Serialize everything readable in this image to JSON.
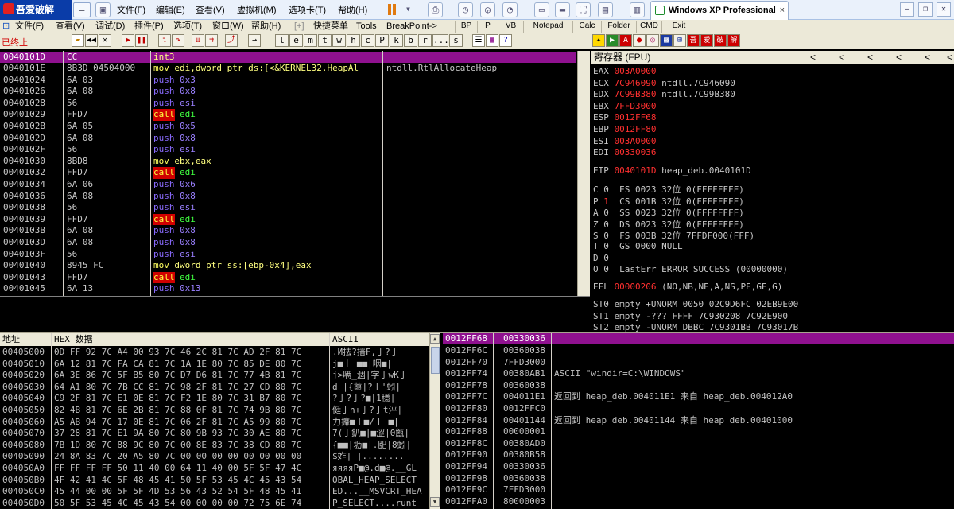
{
  "vm_bar": {
    "brand": "吾爱破解",
    "minimize_label": "–",
    "menus": [
      "文件(F)",
      "编辑(E)",
      "查看(V)",
      "虚拟机(M)",
      "选项卡(T)",
      "帮助(H)"
    ],
    "tab_title": "Windows XP Professional",
    "tab_close": "×"
  },
  "od_menu": {
    "items": [
      "文件(F)",
      "查看(V)",
      "调试(D)",
      "插件(P)",
      "选项(T)",
      "窗口(W)",
      "帮助(H)"
    ],
    "quick_label": "快捷菜单",
    "tools_label": "Tools",
    "breakpoint_label": "BreakPoint->",
    "plugins": [
      "BP",
      "P",
      "VB",
      "Notepad",
      "Calc",
      "Folder",
      "CMD",
      "Exit"
    ]
  },
  "toolbar": {
    "status": "已终止",
    "letters": [
      "l",
      "e",
      "m",
      "t",
      "w",
      "h",
      "c",
      "P",
      "k",
      "b",
      "r",
      "...",
      "s"
    ]
  },
  "cpu": {
    "header": [
      "0040101D",
      "CC",
      "int3"
    ],
    "rows": [
      {
        "addr": "0040101E",
        "hex": "8B3D 04504000",
        "mn": "mov",
        "ops": "edi,dword ptr ds:[<&KERNEL32.HeapAl",
        "cmt": "ntdll.RtlAllocateHeap",
        "t": "mov"
      },
      {
        "addr": "00401024",
        "hex": "6A 03",
        "mn": "push",
        "ops": "0x3",
        "t": "push"
      },
      {
        "addr": "00401026",
        "hex": "6A 08",
        "mn": "push",
        "ops": "0x8",
        "t": "push"
      },
      {
        "addr": "00401028",
        "hex": "56",
        "mn": "push",
        "ops": "esi",
        "t": "push"
      },
      {
        "addr": "00401029",
        "hex": "FFD7",
        "mn": "call",
        "ops": "edi",
        "t": "call"
      },
      {
        "addr": "0040102B",
        "hex": "6A 05",
        "mn": "push",
        "ops": "0x5",
        "t": "push"
      },
      {
        "addr": "0040102D",
        "hex": "6A 08",
        "mn": "push",
        "ops": "0x8",
        "t": "push"
      },
      {
        "addr": "0040102F",
        "hex": "56",
        "mn": "push",
        "ops": "esi",
        "t": "push"
      },
      {
        "addr": "00401030",
        "hex": "8BD8",
        "mn": "mov",
        "ops": "ebx,eax",
        "t": "mov"
      },
      {
        "addr": "00401032",
        "hex": "FFD7",
        "mn": "call",
        "ops": "edi",
        "t": "call"
      },
      {
        "addr": "00401034",
        "hex": "6A 06",
        "mn": "push",
        "ops": "0x6",
        "t": "push"
      },
      {
        "addr": "00401036",
        "hex": "6A 08",
        "mn": "push",
        "ops": "0x8",
        "t": "push"
      },
      {
        "addr": "00401038",
        "hex": "56",
        "mn": "push",
        "ops": "esi",
        "t": "push"
      },
      {
        "addr": "00401039",
        "hex": "FFD7",
        "mn": "call",
        "ops": "edi",
        "t": "call"
      },
      {
        "addr": "0040103B",
        "hex": "6A 08",
        "mn": "push",
        "ops": "0x8",
        "t": "push"
      },
      {
        "addr": "0040103D",
        "hex": "6A 08",
        "mn": "push",
        "ops": "0x8",
        "t": "push"
      },
      {
        "addr": "0040103F",
        "hex": "56",
        "mn": "push",
        "ops": "esi",
        "t": "push"
      },
      {
        "addr": "00401040",
        "hex": "8945 FC",
        "mn": "mov",
        "ops": "dword ptr ss:[ebp-0x4],eax",
        "t": "mov"
      },
      {
        "addr": "00401043",
        "hex": "FFD7",
        "mn": "call",
        "ops": "edi",
        "t": "call"
      },
      {
        "addr": "00401045",
        "hex": "6A 13",
        "mn": "push",
        "ops": "0x13",
        "t": "push"
      }
    ]
  },
  "registers": {
    "title": "寄存器 (FPU)",
    "arrows": [
      "<",
      "<",
      "<",
      "<",
      "<",
      "<"
    ],
    "gp": [
      {
        "name": "EAX",
        "value": "003A0000",
        "note": ""
      },
      {
        "name": "ECX",
        "value": "7C946090",
        "note": "ntdll.7C946090"
      },
      {
        "name": "EDX",
        "value": "7C99B380",
        "note": "ntdll.7C99B380"
      },
      {
        "name": "EBX",
        "value": "7FFD3000",
        "note": ""
      },
      {
        "name": "ESP",
        "value": "0012FF68",
        "note": ""
      },
      {
        "name": "EBP",
        "value": "0012FF80",
        "note": ""
      },
      {
        "name": "ESI",
        "value": "003A0000",
        "note": ""
      },
      {
        "name": "EDI",
        "value": "00330036",
        "note": ""
      }
    ],
    "eip": {
      "name": "EIP",
      "value": "0040101D",
      "note": "heap_deb.0040101D"
    },
    "flags": [
      {
        "f": "C",
        "v": "0",
        "seg": "ES 0023 32位 0(FFFFFFFF)"
      },
      {
        "f": "P",
        "v": "1",
        "seg": "CS 001B 32位 0(FFFFFFFF)"
      },
      {
        "f": "A",
        "v": "0",
        "seg": "SS 0023 32位 0(FFFFFFFF)"
      },
      {
        "f": "Z",
        "v": "0",
        "seg": "DS 0023 32位 0(FFFFFFFF)"
      },
      {
        "f": "S",
        "v": "0",
        "seg": "FS 003B 32位 7FFDF000(FFF)"
      },
      {
        "f": "T",
        "v": "0",
        "seg": "GS 0000 NULL"
      },
      {
        "f": "D",
        "v": "0",
        "seg": ""
      },
      {
        "f": "O",
        "v": "0",
        "seg": "LastErr ERROR_SUCCESS (00000000)"
      }
    ],
    "efl": {
      "name": "EFL",
      "value": "00000206",
      "note": "(NO,NB,NE,A,NS,PE,GE,G)"
    },
    "fpu": [
      "ST0 empty +UNORM 0050 02C9D6FC 02EB9E00",
      "ST1 empty -??? FFFF 7C930208 7C92E900",
      "ST2 empty -UNORM DBBC 7C9301BB 7C93017B"
    ]
  },
  "dump": {
    "headers": [
      "地址",
      "HEX 数据",
      "ASCII"
    ],
    "rows": [
      {
        "addr": "00405000",
        "hex": "0D FF 92 7C A4 00 93 7C 46 2C 81 7C AD 2F 81 7C",
        "ascii": ".И抾?搢F,亅?亅"
      },
      {
        "addr": "00405010",
        "hex": "6A 12 81 7C FA CA 81 7C 1A 1E 80 7C 85 DE 80 7C",
        "ascii": "j■亅 ■■|咽■|"
      },
      {
        "addr": "00405020",
        "hex": "6A 3E 86 7C 5F B5 80 7C D7 D6 81 7C 77 4B 81 7C",
        "ascii": "j>唡_涸|字亅wK亅"
      },
      {
        "addr": "00405030",
        "hex": "64 A1 80 7C 7B CC 81 7C 98 2F 81 7C 27 CD 80 7C",
        "ascii": "d |{蘁|?亅'蚓|"
      },
      {
        "addr": "00405040",
        "hex": "C9 2F 81 7C E1 0E 81 7C F2 1E 80 7C 31 B7 80 7C",
        "ascii": "?亅?亅?■|1穩|"
      },
      {
        "addr": "00405050",
        "hex": "82 4B 81 7C 6E 2B 81 7C 88 0F 81 7C 74 9B 80 7C",
        "ascii": "侹亅n+亅?亅t泙|"
      },
      {
        "addr": "00405060",
        "hex": "A5 AB 94 7C 17 0E 81 7C 06 2F 81 7C A5 99 80 7C",
        "ascii": "力攠■亅■/亅 ■|"
      },
      {
        "addr": "00405070",
        "hex": "37 28 81 7C E1 9A 80 7C 80 9B 93 7C 30 AE 80 7C",
        "ascii": "7(亅釟■|■涩|0甔|"
      },
      {
        "addr": "00405080",
        "hex": "7B 1D 80 7C 88 9C 80 7C 00 8E 83 7C 38 CD 80 7C",
        "ascii": "{■■|坜■|.巸|8蚓|"
      },
      {
        "addr": "00405090",
        "hex": "24 8A 83 7C 20 A5 80 7C 00 00 00 00 00 00 00 00",
        "ascii": "$妰| |........"
      },
      {
        "addr": "004050A0",
        "hex": "FF FF FF FF 50 11 40 00 64 11 40 00 5F 5F 47 4C",
        "ascii": "яяяяP■@.d■@.__GL"
      },
      {
        "addr": "004050B0",
        "hex": "4F 42 41 4C 5F 48 45 41 50 5F 53 45 4C 45 43 54",
        "ascii": "OBAL_HEAP_SELECT"
      },
      {
        "addr": "004050C0",
        "hex": "45 44 00 00 5F 5F 4D 53 56 43 52 54 5F 48 45 41",
        "ascii": "ED...__MSVCRT_HEA"
      },
      {
        "addr": "004050D0",
        "hex": "50 5F 53 45 4C 45 43 54 00 00 00 00 72 75 6E 74",
        "ascii": "P_SELECT....runt"
      }
    ]
  },
  "stack": {
    "header": [
      "0012FF68",
      "00330036"
    ],
    "rows": [
      {
        "addr": "0012FF6C",
        "val": "00360038",
        "cmt": ""
      },
      {
        "addr": "0012FF70",
        "val": "7FFD3000",
        "cmt": ""
      },
      {
        "addr": "0012FF74",
        "val": "00380AB1",
        "cmt": "ASCII \"windir=C:\\WINDOWS\""
      },
      {
        "addr": "0012FF78",
        "val": "00360038",
        "cmt": ""
      },
      {
        "addr": "0012FF7C",
        "val": "004011E1",
        "cmt": "返回到 heap_deb.004011E1 来自 heap_deb.004012A0"
      },
      {
        "addr": "0012FF80",
        "val": "0012FFC0",
        "cmt": ""
      },
      {
        "addr": "0012FF84",
        "val": "00401144",
        "cmt": "返回到 heap_deb.00401144 来自 heap_deb.00401000"
      },
      {
        "addr": "0012FF88",
        "val": "00000001",
        "cmt": ""
      },
      {
        "addr": "0012FF8C",
        "val": "00380AD0",
        "cmt": ""
      },
      {
        "addr": "0012FF90",
        "val": "00380B58",
        "cmt": ""
      },
      {
        "addr": "0012FF94",
        "val": "00330036",
        "cmt": ""
      },
      {
        "addr": "0012FF98",
        "val": "00360038",
        "cmt": ""
      },
      {
        "addr": "0012FF9C",
        "val": "7FFD3000",
        "cmt": ""
      },
      {
        "addr": "0012FFA0",
        "val": "80000003",
        "cmt": ""
      }
    ]
  }
}
